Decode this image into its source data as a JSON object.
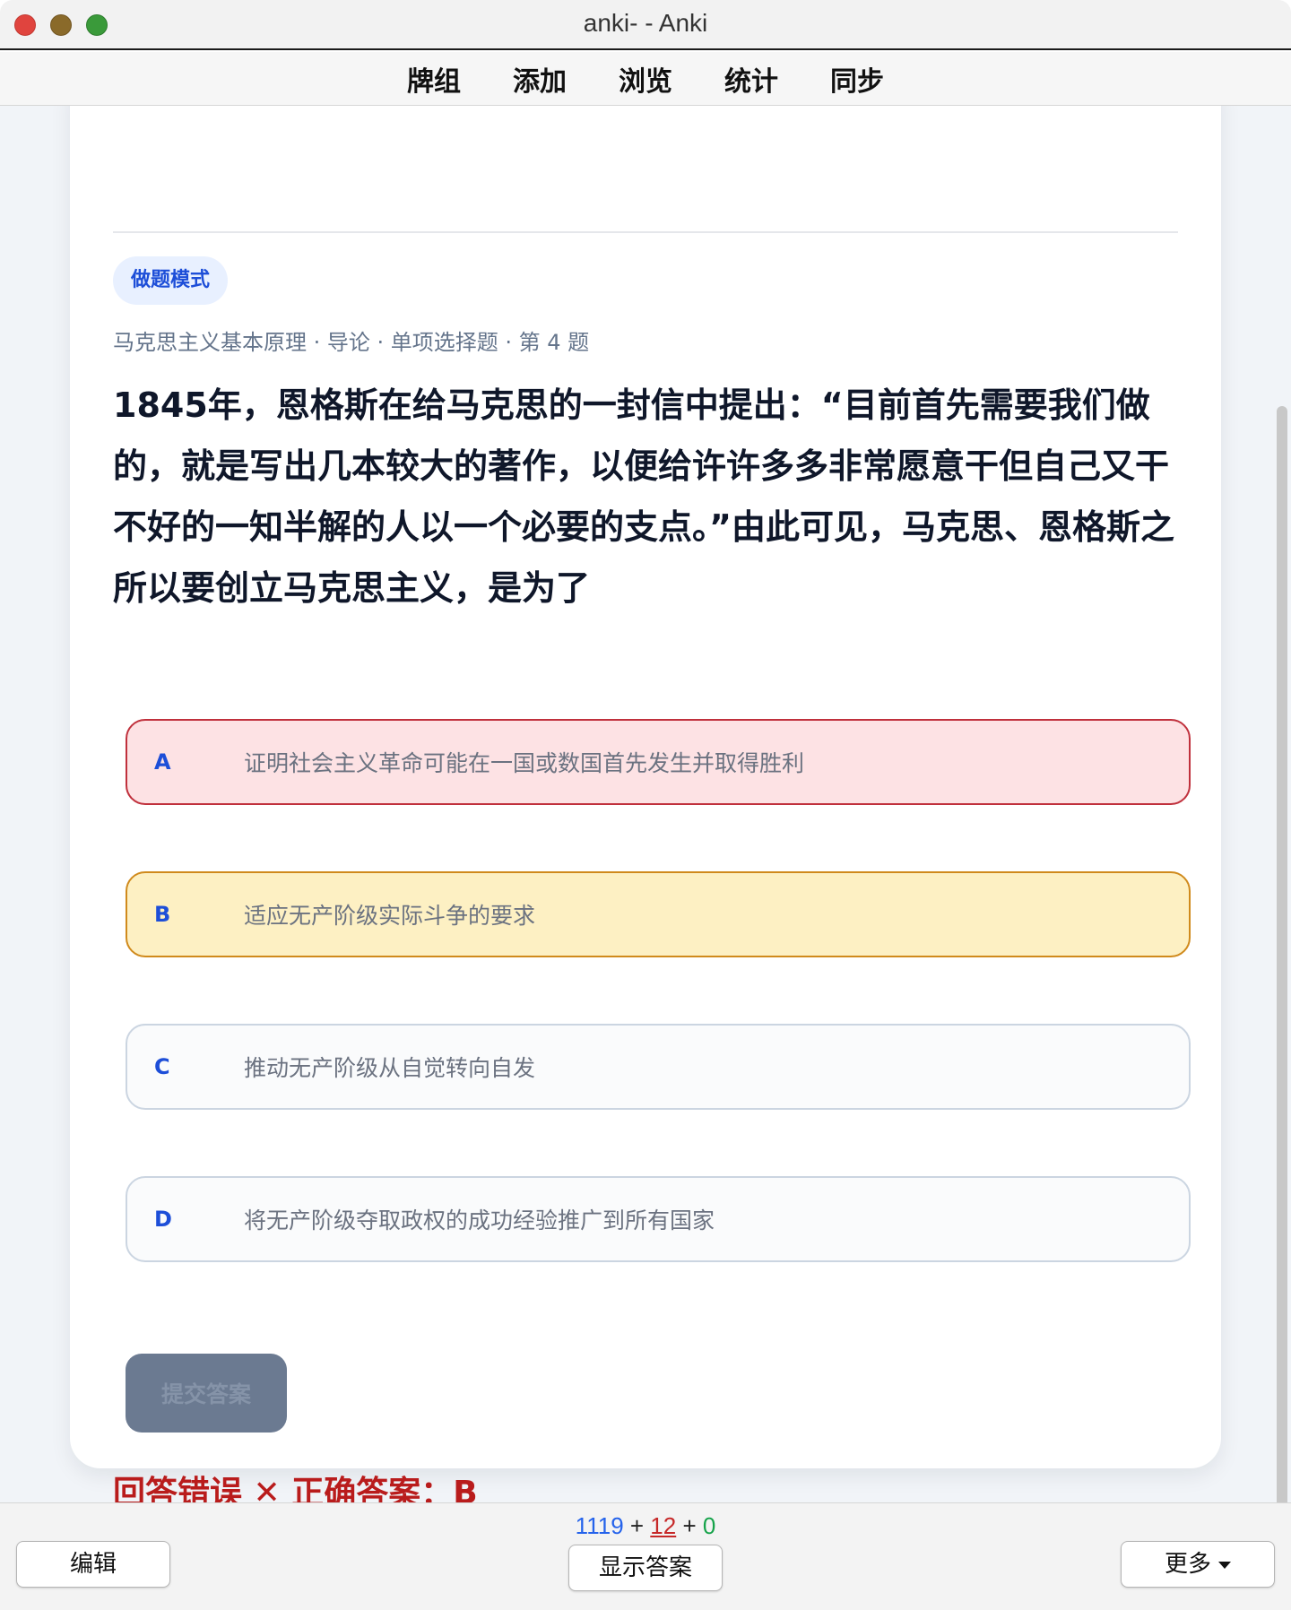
{
  "window": {
    "title": "anki- - Anki"
  },
  "nav": {
    "items": [
      "牌组",
      "添加",
      "浏览",
      "统计",
      "同步"
    ]
  },
  "card": {
    "mode_badge": "做题模式",
    "breadcrumb": "马克思主义基本原理 · 导论 · 单项选择题 · 第 4 题",
    "question": "1845年，恩格斯在给马克思的一封信中提出：“目前首先需要我们做的，就是写出几本较大的著作，以便给许许多多非常愿意干但自己又干不好的一知半解的人以一个必要的支点。”由此可见，马克思、恩格斯之所以要创立马克思主义，是为了",
    "options": [
      {
        "letter": "A",
        "text": "证明社会主义革命可能在一国或数国首先发生并取得胜利",
        "state": "wrong"
      },
      {
        "letter": "B",
        "text": "适应无产阶级实际斗争的要求",
        "state": "correct"
      },
      {
        "letter": "C",
        "text": "推动无产阶级从自觉转向自发",
        "state": "normal"
      },
      {
        "letter": "D",
        "text": "将无产阶级夺取政权的成功经验推广到所有国家",
        "state": "normal"
      }
    ],
    "submit_label": "提交答案",
    "result_text": "回答错误 ✕ 正确答案：B"
  },
  "bottom": {
    "count_new": "1119",
    "plus1": " + ",
    "count_learn": "12",
    "plus2": " + ",
    "count_review": "0",
    "edit_label": "编辑",
    "show_answer_label": "显示答案",
    "more_label": "更多"
  },
  "colors": {
    "accent": "#1d4ed8",
    "wrong_bg": "#fde2e4",
    "correct_bg": "#fdf0c3",
    "result": "#b91c1c"
  }
}
